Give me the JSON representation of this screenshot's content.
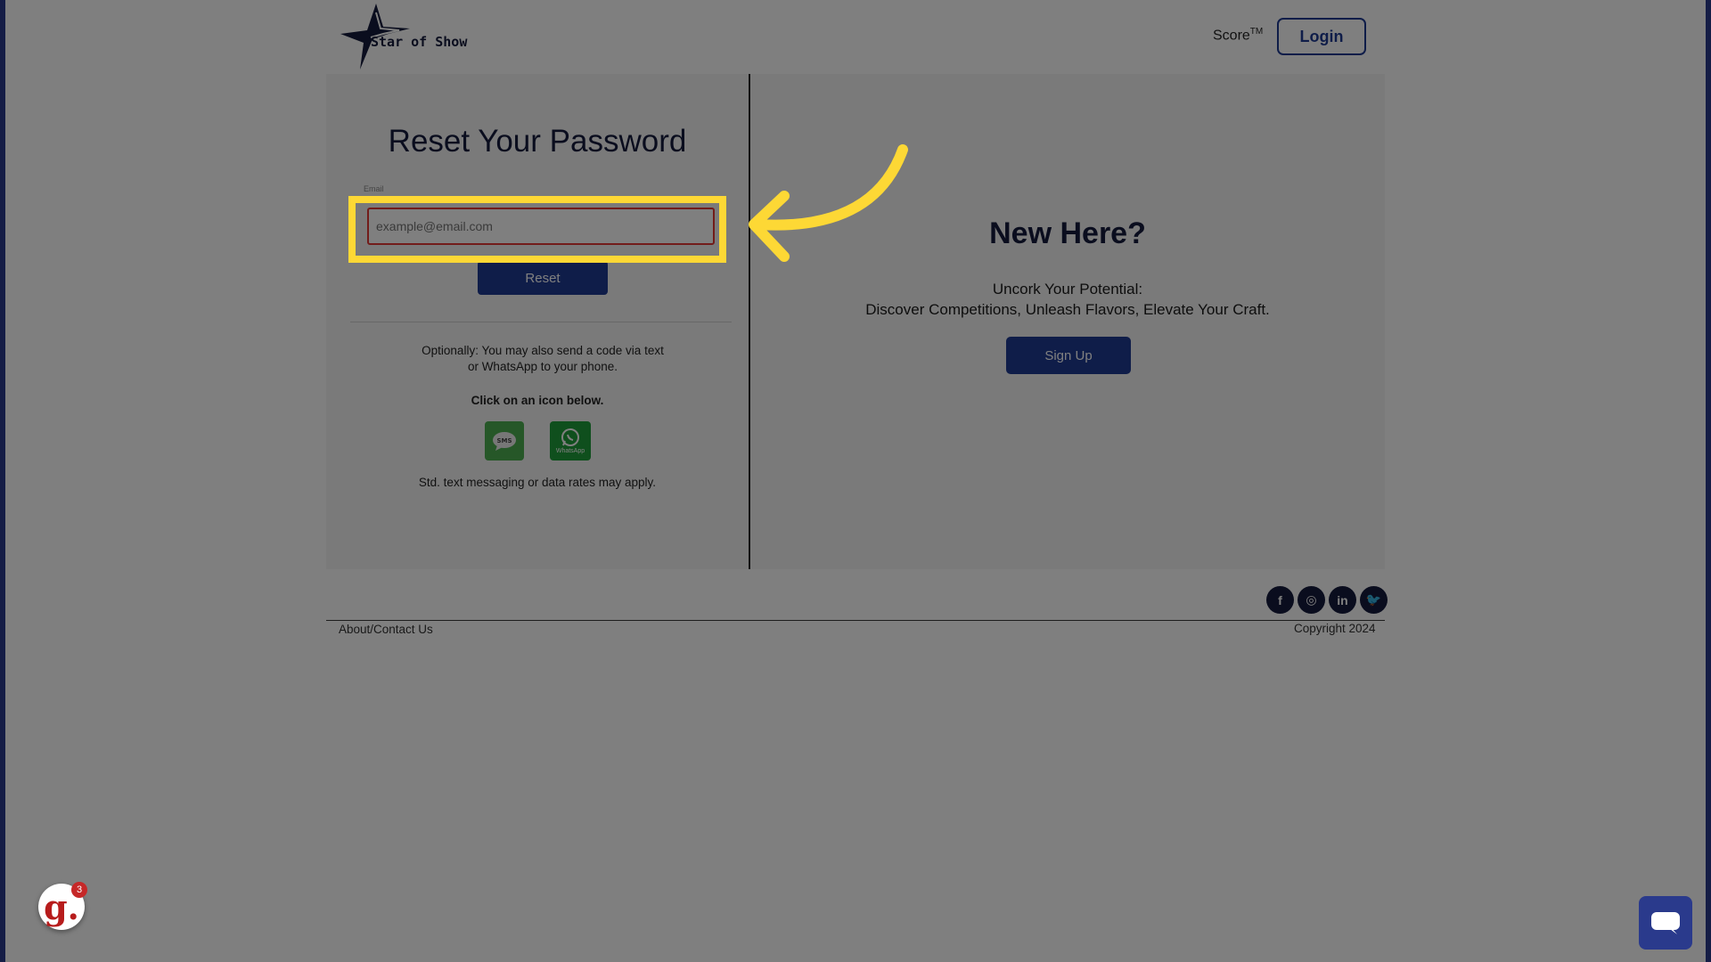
{
  "header": {
    "logo_text": "Star of Show",
    "score_label": "Score",
    "score_tm": "TM",
    "login_label": "Login"
  },
  "reset": {
    "title": "Reset Your Password",
    "email_label": "Email",
    "email_placeholder": "example@email.com",
    "email_value": "",
    "reset_label": "Reset",
    "optional_text": "Optionally: You may also send a code via text or WhatsApp to your phone.",
    "click_text": "Click on an icon below.",
    "sms_caption": "SMS",
    "whatsapp_caption": "WhatsApp",
    "rates_text": "Std. text messaging or data rates may apply."
  },
  "signup": {
    "title": "New Here?",
    "line1": "Uncork Your Potential:",
    "line2": "Discover Competitions, Unleash Flavors, Elevate Your Craft.",
    "button_label": "Sign Up"
  },
  "footer": {
    "about_label": "About/Contact Us",
    "copyright": "Copyright 2024",
    "socials": [
      {
        "name": "facebook-icon",
        "glyph": "f"
      },
      {
        "name": "instagram-icon",
        "glyph": "◎"
      },
      {
        "name": "linkedin-icon",
        "glyph": "in"
      },
      {
        "name": "twitter-icon",
        "glyph": "🐦"
      }
    ]
  },
  "widgets": {
    "g_letter": "g.",
    "g_count": "3"
  },
  "colors": {
    "brand_navy": "#1f3a93",
    "dark_text": "#141a3c",
    "highlight_yellow": "#fdd835",
    "error_red": "#e53935"
  }
}
